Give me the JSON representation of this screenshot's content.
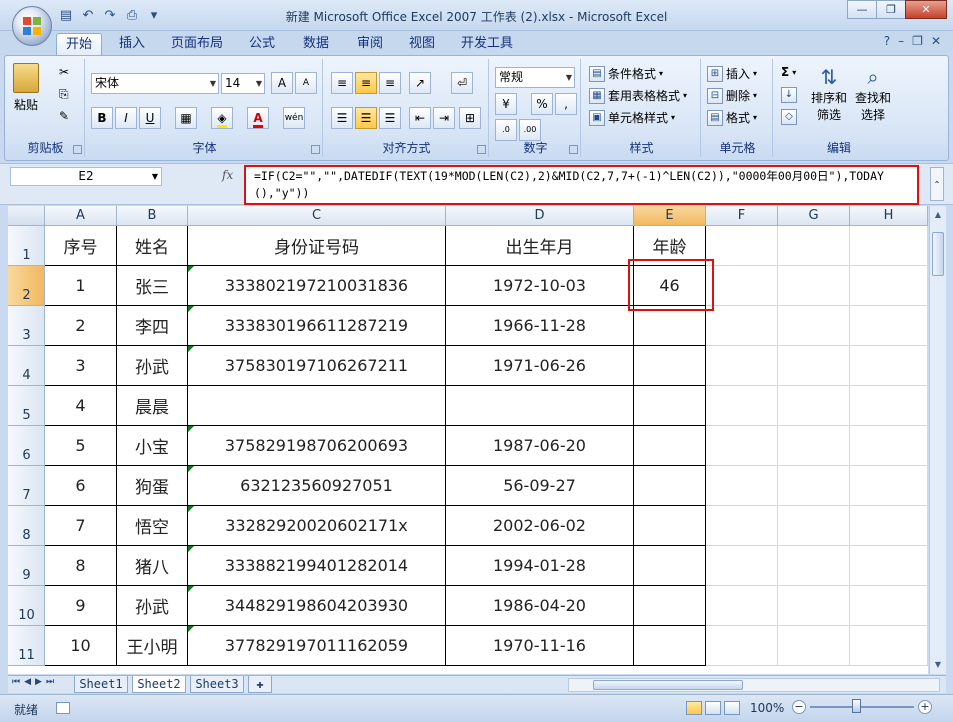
{
  "window": {
    "title": "新建 Microsoft Office Excel 2007 工作表 (2).xlsx - Microsoft Excel",
    "minimize": "—",
    "restore": "❐",
    "close": "✕"
  },
  "tabs": [
    "开始",
    "插入",
    "页面布局",
    "公式",
    "数据",
    "审阅",
    "视图",
    "开发工具"
  ],
  "ribbon": {
    "clipboard": {
      "paste": "粘贴",
      "label": "剪贴板"
    },
    "font": {
      "name": "宋体",
      "size": "14",
      "label": "字体",
      "grow": "A",
      "shrink": "A",
      "bold": "B",
      "italic": "I",
      "underline": "U",
      "wen": "wén"
    },
    "alignment": {
      "label": "对齐方式"
    },
    "number": {
      "format": "常规",
      "percent": "%",
      "comma": ",",
      "label": "数字"
    },
    "styles": {
      "conditional": "条件格式",
      "table": "套用表格格式",
      "cell": "单元格样式",
      "label": "样式"
    },
    "cells": {
      "insert": "插入",
      "delete": "删除",
      "format": "格式",
      "label": "单元格"
    },
    "editing": {
      "sigma": "Σ",
      "sort": "排序和",
      "sort2": "筛选",
      "find": "查找和",
      "find2": "选择",
      "label": "编辑"
    }
  },
  "formula_bar": {
    "name_box": "E2",
    "fx": "fx",
    "formula": "=IF(C2=\"\",\"\",DATEDIF(TEXT(19*MOD(LEN(C2),2)&MID(C2,7,7+(-1)^LEN(C2)),\"0000年00月00日\"),TODAY(),\"y\"))"
  },
  "columns": [
    "A",
    "B",
    "C",
    "D",
    "E",
    "F",
    "G",
    "H"
  ],
  "rows": [
    "1",
    "2",
    "3",
    "4",
    "5",
    "6",
    "7",
    "8",
    "9",
    "10",
    "11"
  ],
  "table": {
    "headers": [
      "序号",
      "姓名",
      "身份证号码",
      "出生年月",
      "年龄"
    ],
    "rows": [
      [
        "1",
        "张三",
        "333802197210031836",
        "1972-10-03",
        "46"
      ],
      [
        "2",
        "李四",
        "333830196611287219",
        "1966-11-28",
        ""
      ],
      [
        "3",
        "孙武",
        "375830197106267211",
        "1971-06-26",
        ""
      ],
      [
        "4",
        "晨晨",
        "",
        "",
        ""
      ],
      [
        "5",
        "小宝",
        "375829198706200693",
        "1987-06-20",
        ""
      ],
      [
        "6",
        "狗蛋",
        "632123560927051",
        "56-09-27",
        ""
      ],
      [
        "7",
        "悟空",
        "33282920020602171x",
        "2002-06-02",
        ""
      ],
      [
        "8",
        "猪八",
        "333882199401282014",
        "1994-01-28",
        ""
      ],
      [
        "9",
        "孙武",
        "344829198604203930",
        "1986-04-20",
        ""
      ],
      [
        "10",
        "王小明",
        "377829197011162059",
        "1970-11-16",
        ""
      ]
    ]
  },
  "sheets": [
    "Sheet1",
    "Sheet2",
    "Sheet3"
  ],
  "active_sheet": "Sheet2",
  "status": {
    "ready": "就绪",
    "zoom": "100%"
  },
  "colors": {
    "highlight": "#e01010",
    "header_sel": "#f1b85e",
    "ribbon_bg": "#d9e6f6"
  }
}
